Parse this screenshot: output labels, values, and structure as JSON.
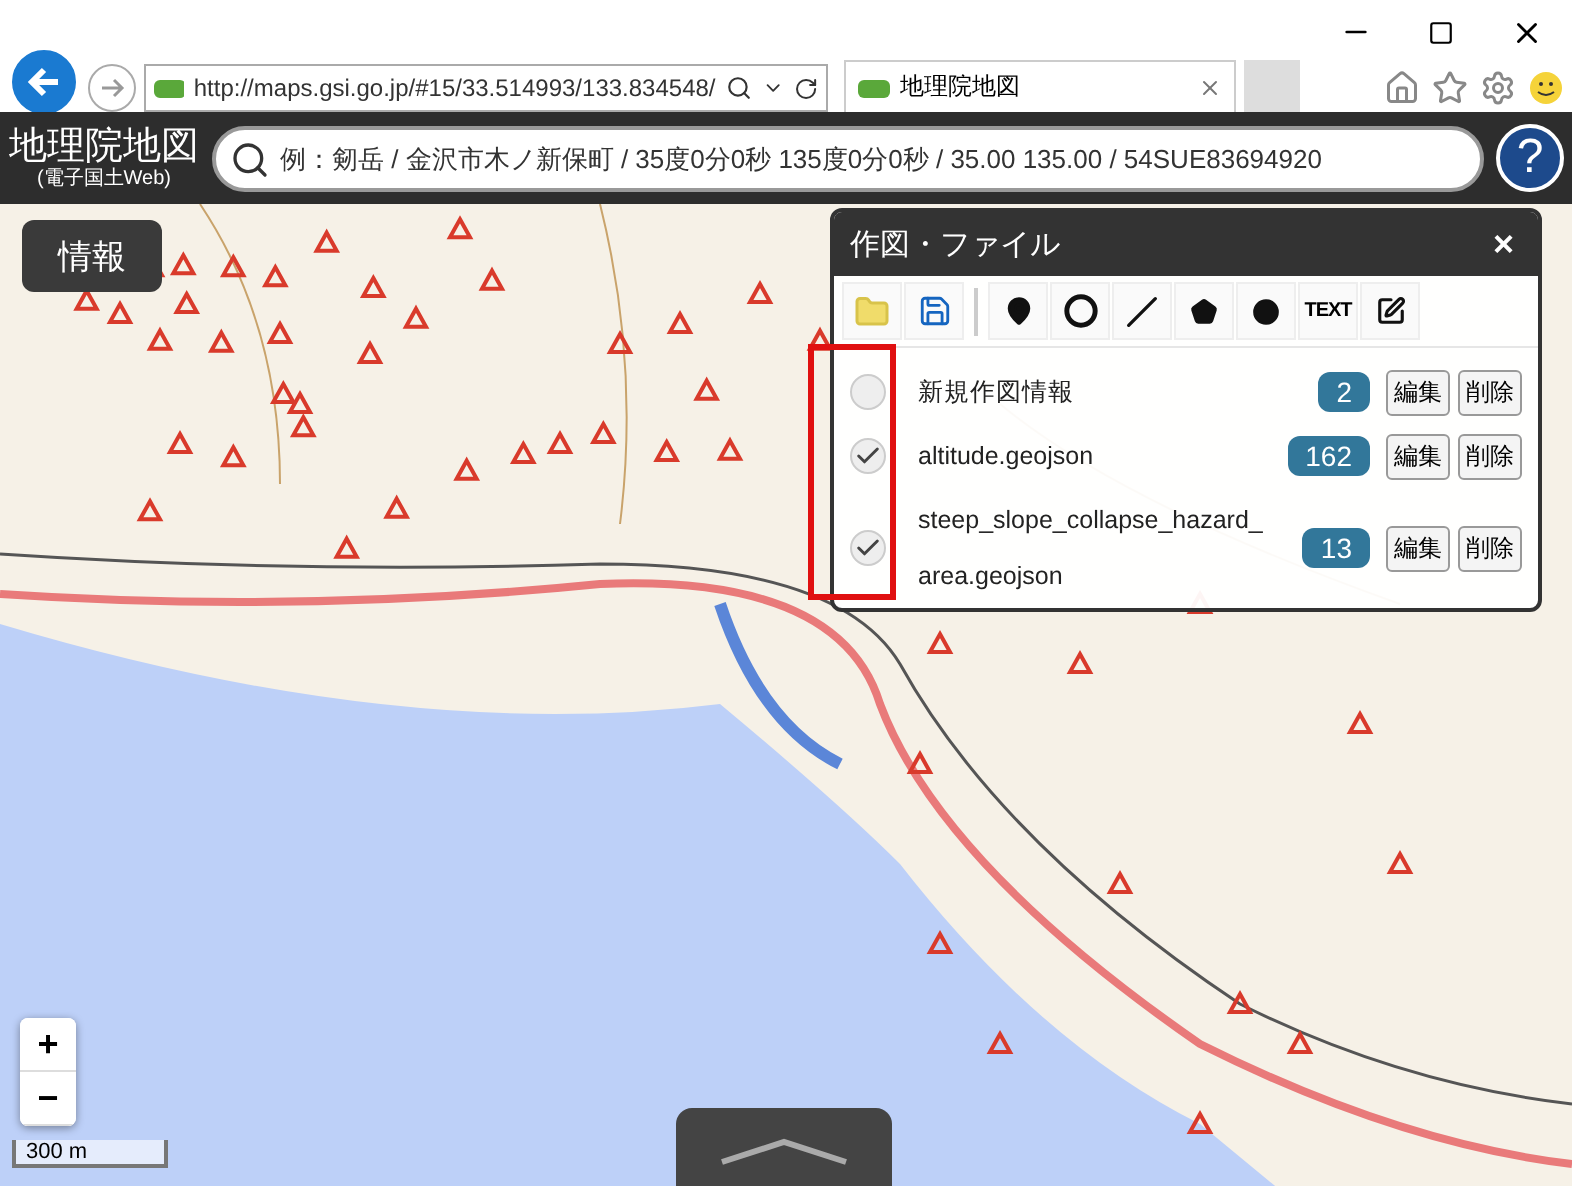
{
  "browser": {
    "url": "http://maps.gsi.go.jp/#15/33.514993/133.834548/",
    "tab_title": "地理院地図"
  },
  "app": {
    "title": "地理院地図",
    "subtitle": "(電子国土Web)",
    "search_placeholder": "例：剱岳 / 金沢市木ノ新保町 / 35度0分0秒 135度0分0秒 / 35.00 135.00 / 54SUE83694920"
  },
  "help": "?",
  "info_button": "情報",
  "panel": {
    "title": "作図・ファイル",
    "close": "×",
    "tools": [
      {
        "kind": "open"
      },
      {
        "kind": "save"
      },
      {
        "kind": "marker"
      },
      {
        "kind": "circle"
      },
      {
        "kind": "line"
      },
      {
        "kind": "polygon"
      },
      {
        "kind": "dot"
      },
      {
        "kind": "text",
        "label": "TEXT"
      },
      {
        "kind": "edit"
      }
    ],
    "layers": [
      {
        "name": "新規作図情報",
        "checked": false,
        "count": "2",
        "edit": "編集",
        "delete": "削除"
      },
      {
        "name": "altitude.geojson",
        "checked": true,
        "count": "162",
        "edit": "編集",
        "delete": "削除"
      },
      {
        "name": "steep_slope_collapse_hazard_area.geojson",
        "checked": true,
        "count": "13",
        "edit": "編集",
        "delete": "削除"
      }
    ]
  },
  "zoom": {
    "in": "+",
    "out": "−"
  },
  "scale": "300 m"
}
